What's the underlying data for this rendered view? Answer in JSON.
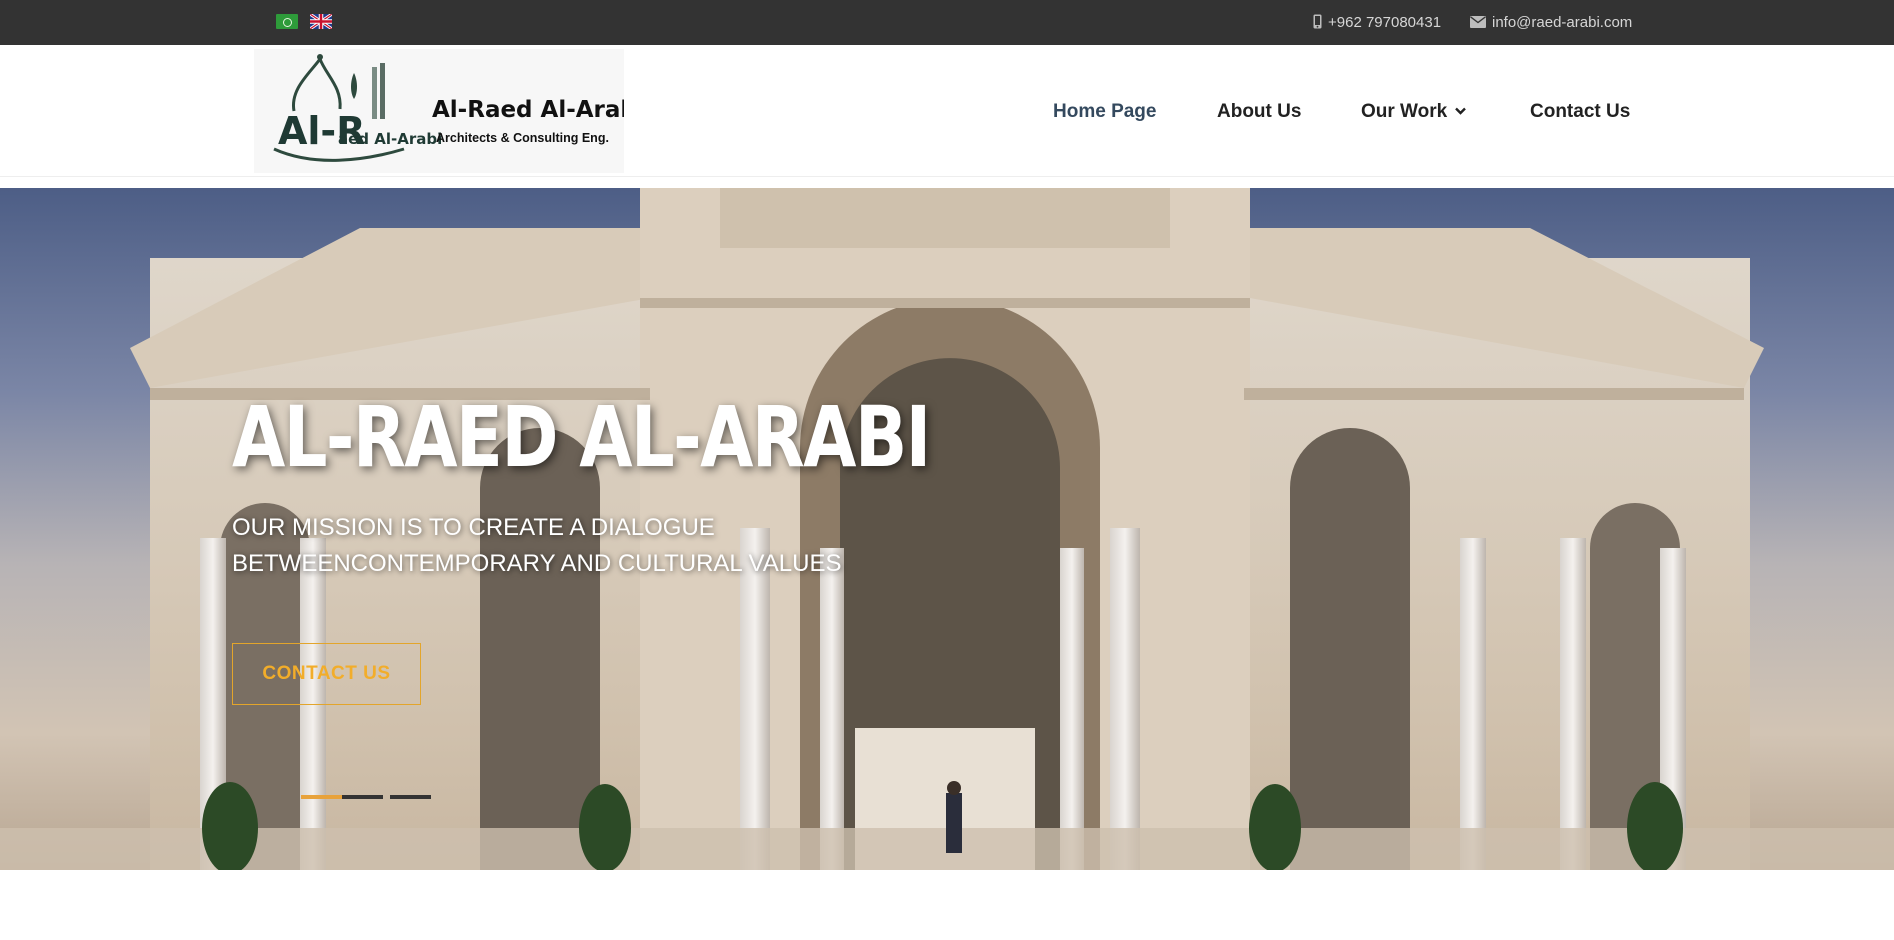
{
  "topbar": {
    "flags": [
      "arabic-flag-icon",
      "uk-flag-icon"
    ],
    "phone": "+962 797080431",
    "email": "info@raed-arabi.com"
  },
  "header": {
    "logo_main": "Al-Raed Al-Arabi",
    "logo_sub": "Architects & Consulting Eng.",
    "logo_mark": "Al-R",
    "logo_mark_small": "aed Al-Arabi",
    "nav": {
      "home": "Home Page",
      "about": "About Us",
      "work": "Our Work",
      "contact": "Contact Us"
    }
  },
  "hero": {
    "title": "AL-RAED AL-ARABI",
    "subtitle_line1": "OUR MISSION IS TO CREATE A DIALOGUE",
    "subtitle_line2": "BETWEENCONTEMPORARY AND CULTURAL VALUES",
    "cta": "CONTACT US",
    "active_slide": 1,
    "slide_count": 3
  },
  "colors": {
    "topbar_bg": "#333333",
    "accent": "#e8a23a",
    "nav_active": "#34495e"
  }
}
